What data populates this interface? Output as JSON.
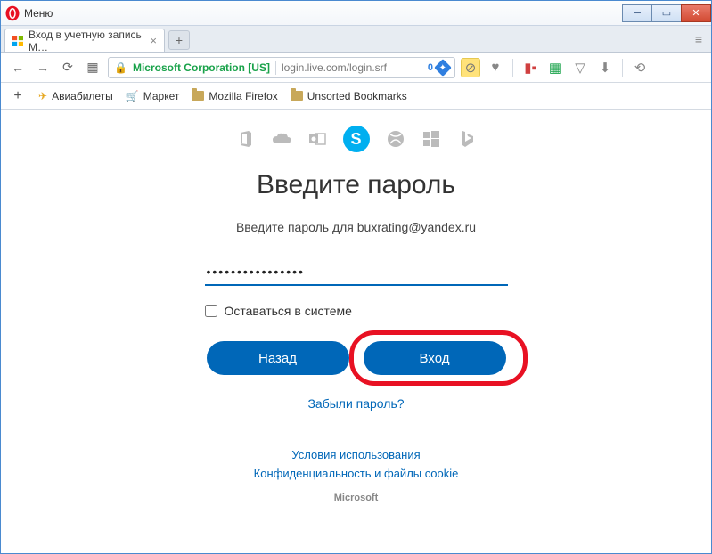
{
  "titlebar": {
    "menu": "Меню"
  },
  "tab": {
    "title": "Вход в учетную запись M…"
  },
  "addressbar": {
    "identity": "Microsoft Corporation [US]",
    "url": "login.live.com/login.srf",
    "badge_count": "0"
  },
  "bookmarks": {
    "aviabilety": "Авиабилеты",
    "market": "Маркет",
    "firefox": "Mozilla Firefox",
    "unsorted": "Unsorted Bookmarks"
  },
  "page": {
    "heading": "Введите пароль",
    "subtitle": "Введите пароль для buxrating@yandex.ru",
    "password_value": "••••••••••••••••",
    "keep_signed_in": "Оставаться в системе",
    "back": "Назад",
    "signin": "Вход",
    "forgot": "Забыли пароль?",
    "terms": "Условия использования",
    "privacy": "Конфиденциальность и файлы cookie",
    "footer": "Microsoft"
  }
}
